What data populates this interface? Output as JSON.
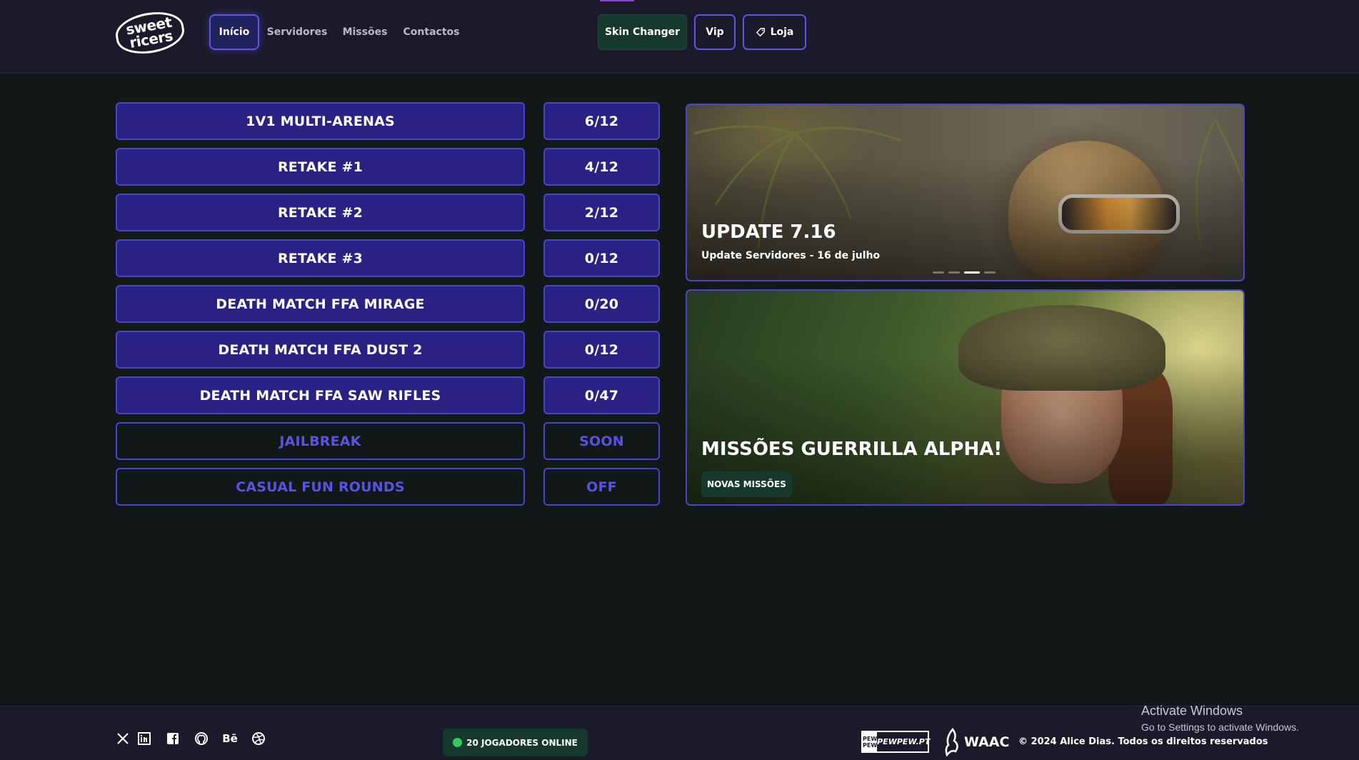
{
  "header": {
    "logo_line1": "sweet",
    "logo_line2": "ricers",
    "nav": [
      {
        "label": "Início"
      },
      {
        "label": "Servidores"
      },
      {
        "label": "Missões"
      },
      {
        "label": "Contactos"
      }
    ],
    "buttons": {
      "skin_changer": "Skin Changer",
      "vip": "Vip",
      "loja": "Loja"
    }
  },
  "servers": [
    {
      "name": "1V1 MULTI-ARENAS",
      "players": "6/12"
    },
    {
      "name": "RETAKE #1",
      "players": "4/12"
    },
    {
      "name": "RETAKE #2",
      "players": "2/12"
    },
    {
      "name": "RETAKE #3",
      "players": "0/12"
    },
    {
      "name": "DEATH MATCH FFA MIRAGE",
      "players": "0/20"
    },
    {
      "name": "DEATH MATCH FFA DUST 2",
      "players": "0/12"
    },
    {
      "name": "DEATH MATCH FFA SAW RIFLES",
      "players": "0/47"
    },
    {
      "name": "JAILBREAK",
      "players": "SOON"
    },
    {
      "name": "CASUAL FUN ROUNDS",
      "players": "OFF"
    }
  ],
  "banners": {
    "update": {
      "title": "UPDATE 7.16",
      "subtitle": "Update Servidores - 16 de julho"
    },
    "missions": {
      "title": "MISSÕES GUERRILLA ALPHA!",
      "tag": "NOVAS MISSÕES"
    }
  },
  "footer": {
    "online": "20 JOGADORES ONLINE",
    "pewpew_box": "PEW PEW",
    "pewpew_text": "PEWPEW.PT",
    "waac": "WAAC",
    "copyright": "© 2024 Alice Dias. Todos os direitos reservados",
    "social_be": "Bē"
  },
  "windows_watermark": {
    "title": "Activate Windows",
    "subtitle": "Go to Settings to activate Windows."
  },
  "colors": {
    "accent": "#5b55e8",
    "server_bg": "#2a2183",
    "green_button": "#17392d",
    "online_dot": "#2ecc5a"
  }
}
